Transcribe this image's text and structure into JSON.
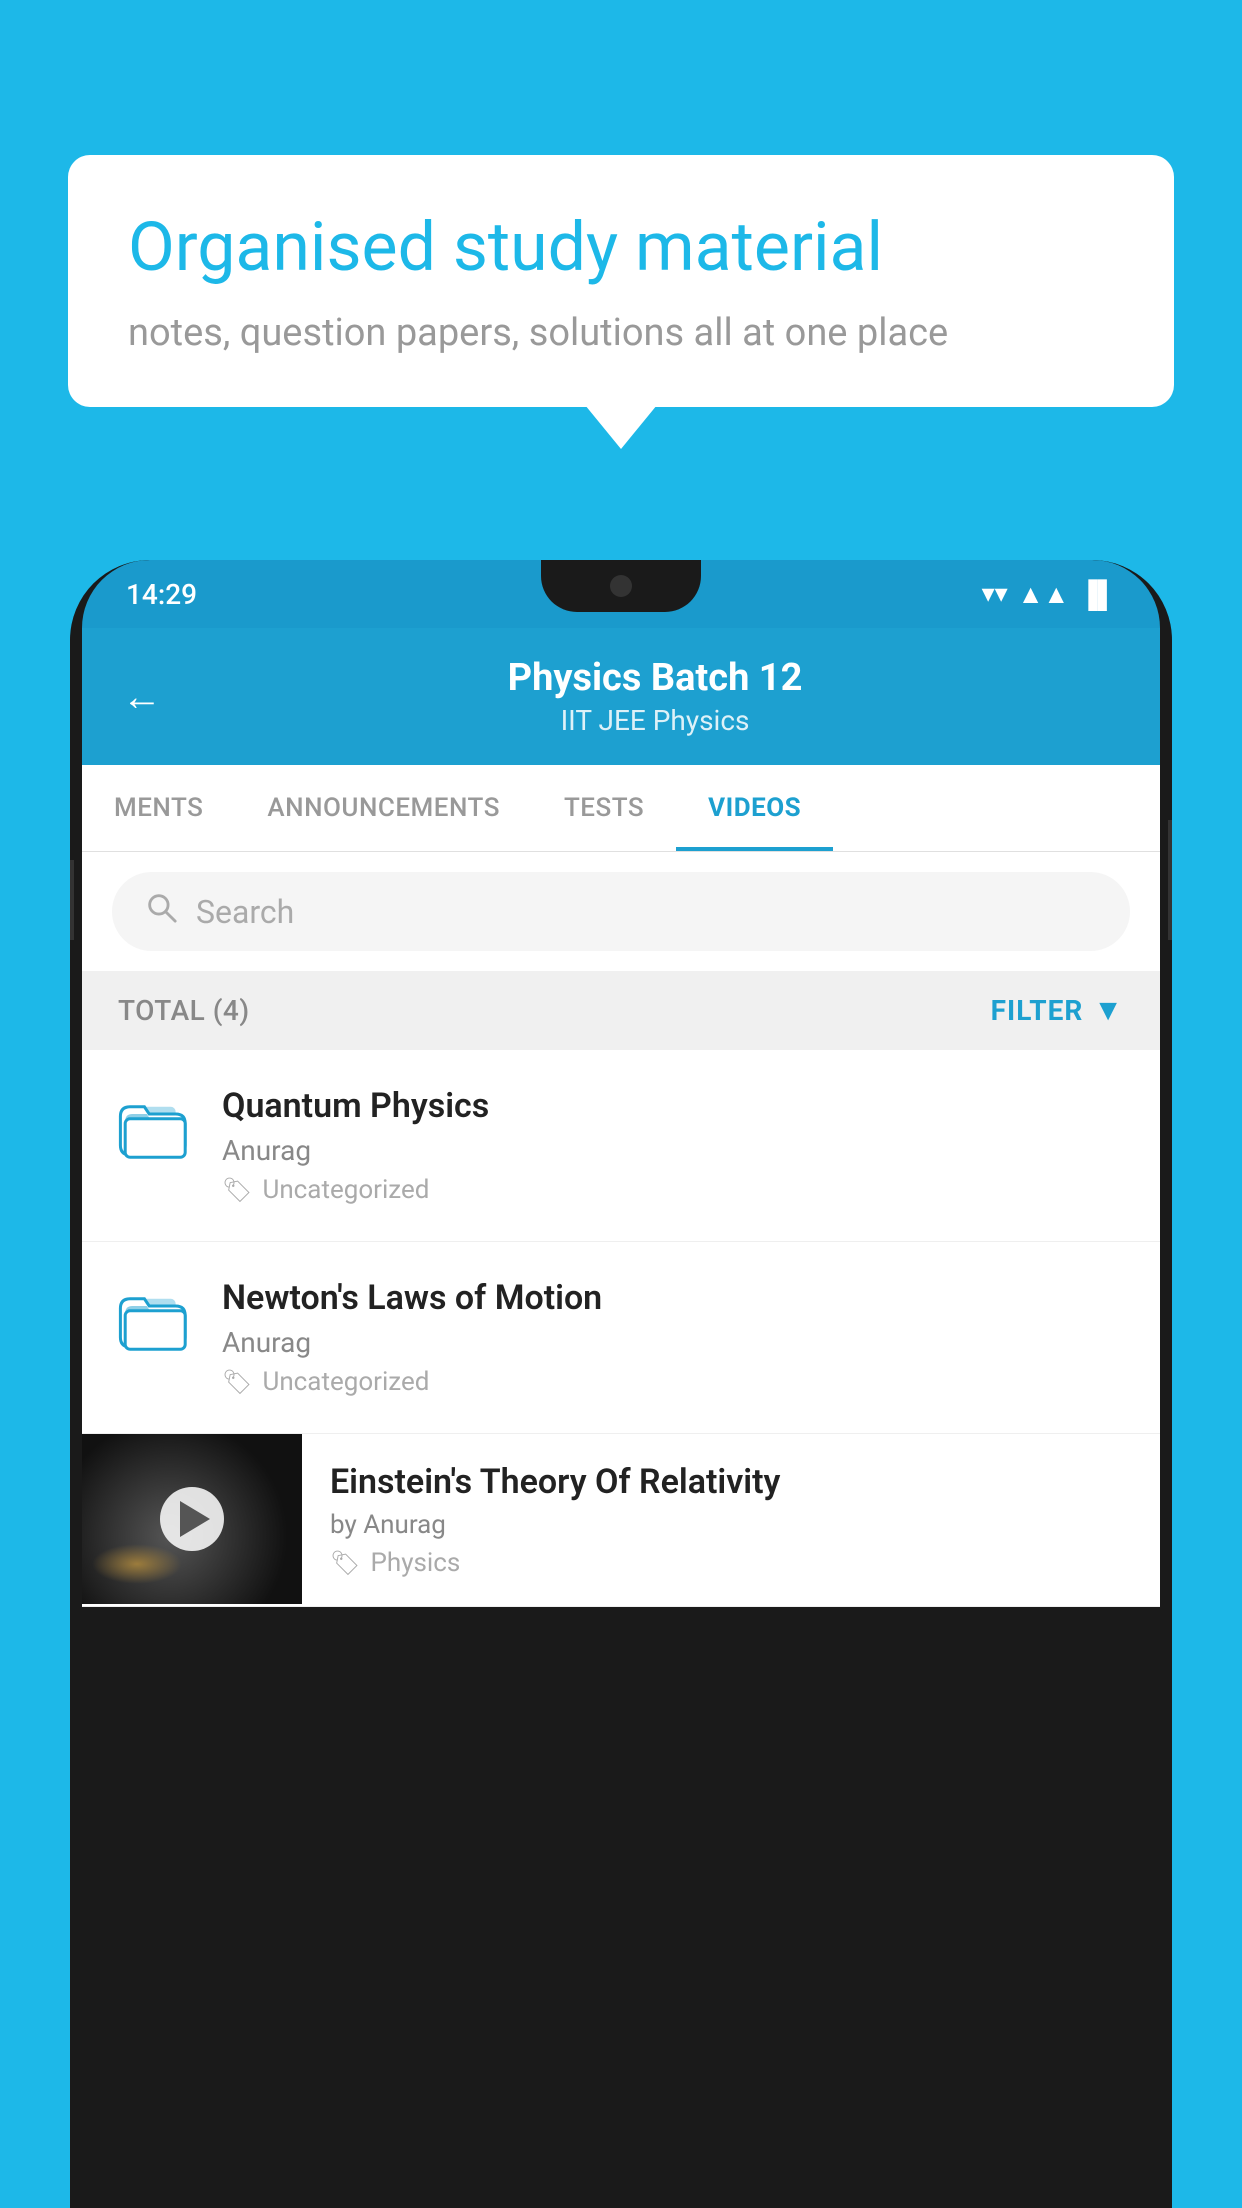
{
  "background_color": "#1db8e8",
  "bubble": {
    "title": "Organised study material",
    "subtitle": "notes, question papers, solutions all at one place"
  },
  "status_bar": {
    "time": "14:29",
    "wifi": "▼",
    "signal": "▲",
    "battery": "▐"
  },
  "header": {
    "back_label": "←",
    "title": "Physics Batch 12",
    "subtitle_part1": "IIT JEE",
    "subtitle_sep": "  ",
    "subtitle_part2": "Physics"
  },
  "tabs": [
    {
      "label": "MENTS",
      "active": false
    },
    {
      "label": "ANNOUNCEMENTS",
      "active": false
    },
    {
      "label": "TESTS",
      "active": false
    },
    {
      "label": "VIDEOS",
      "active": true
    }
  ],
  "search": {
    "placeholder": "Search"
  },
  "filter_bar": {
    "total_label": "TOTAL (4)",
    "filter_label": "FILTER"
  },
  "list_items": [
    {
      "title": "Quantum Physics",
      "author": "Anurag",
      "tag": "Uncategorized",
      "type": "folder"
    },
    {
      "title": "Newton's Laws of Motion",
      "author": "Anurag",
      "tag": "Uncategorized",
      "type": "folder"
    },
    {
      "title": "Einstein's Theory Of Relativity",
      "by_label": "by Anurag",
      "tag": "Physics",
      "type": "video"
    }
  ]
}
